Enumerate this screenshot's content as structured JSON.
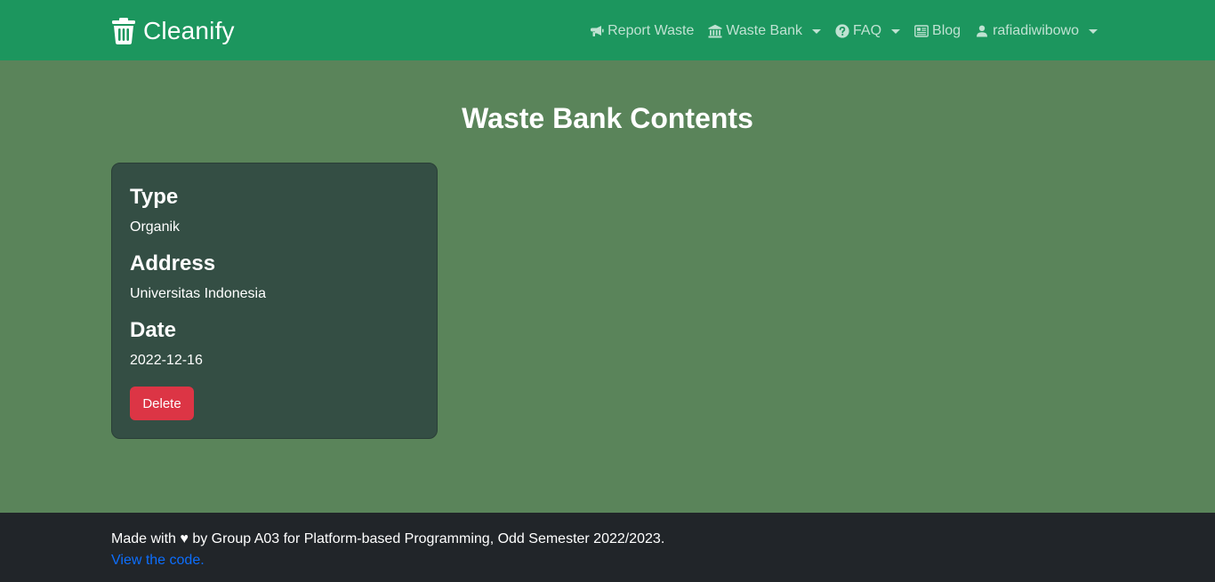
{
  "navbar": {
    "brand": "Cleanify",
    "items": [
      {
        "label": "Report Waste",
        "icon": "megaphone-icon",
        "dropdown": false
      },
      {
        "label": "Waste Bank",
        "icon": "bank-icon",
        "dropdown": true
      },
      {
        "label": "FAQ",
        "icon": "question-circle-icon",
        "dropdown": true
      },
      {
        "label": "Blog",
        "icon": "newspaper-icon",
        "dropdown": false
      },
      {
        "label": "rafiadiwibowo",
        "icon": "user-icon",
        "dropdown": true
      }
    ]
  },
  "main": {
    "title": "Waste Bank Contents",
    "card": {
      "type_label": "Type",
      "type_value": "Organik",
      "address_label": "Address",
      "address_value": "Universitas Indonesia",
      "date_label": "Date",
      "date_value": "2022-12-16",
      "delete_label": "Delete"
    }
  },
  "footer": {
    "text": "Made with ♥ by Group A03 for Platform-based Programming, Odd Semester 2022/2023.",
    "link": "View the code."
  },
  "colors": {
    "navbar": "#1c965e",
    "background": "#5a845a",
    "card": "#344e44",
    "delete": "#dc3545",
    "footer": "#212529",
    "link": "#0d6efd"
  }
}
